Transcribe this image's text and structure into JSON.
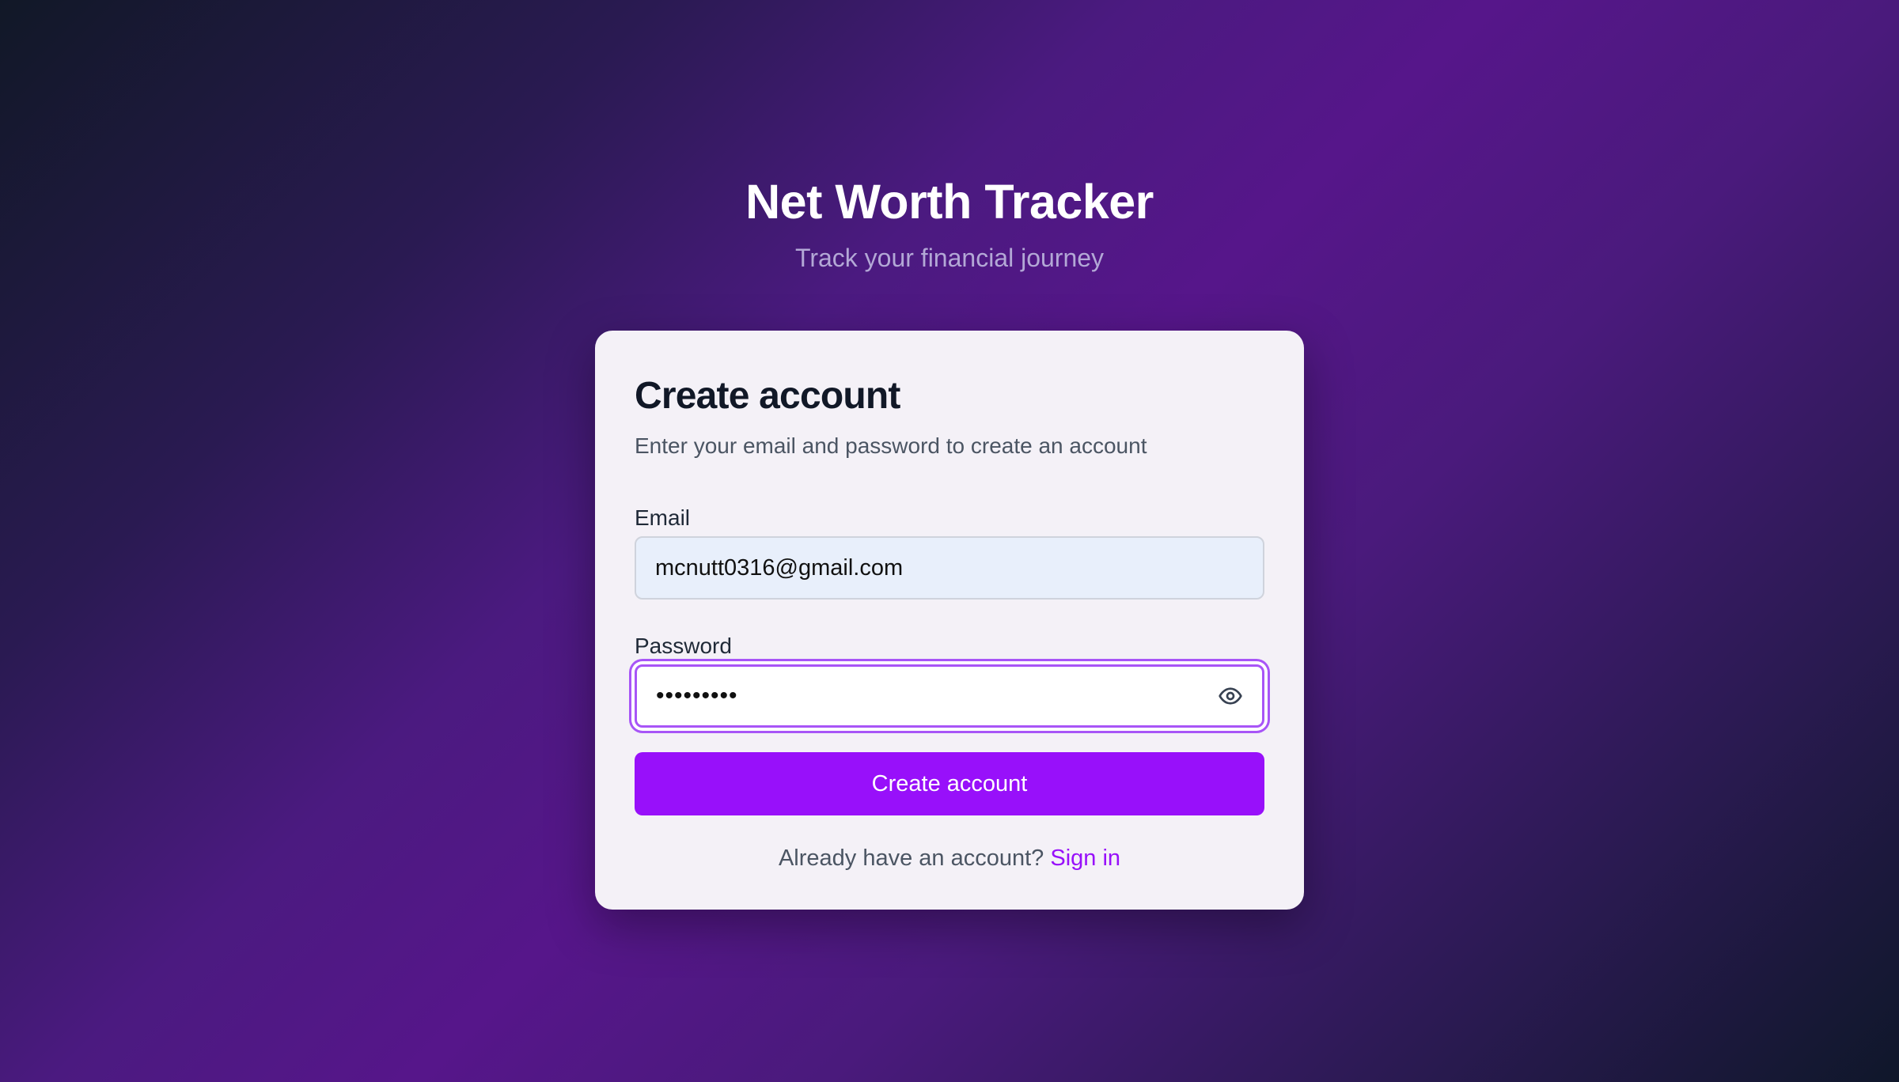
{
  "app": {
    "title": "Net Worth Tracker",
    "subtitle": "Track your financial journey"
  },
  "card": {
    "title": "Create account",
    "description": "Enter your email and password to create an account"
  },
  "form": {
    "email_label": "Email",
    "email_value": "mcnutt0316@gmail.com",
    "password_label": "Password",
    "password_value": "•••••••••",
    "password_toggle_icon": "eye-icon",
    "submit_label": "Create account"
  },
  "footer": {
    "prompt": "Already have an account?",
    "link_label": "Sign in"
  },
  "colors": {
    "accent": "#9810fa",
    "focus_ring": "#a855f7",
    "card_background": "#f4f1f7",
    "email_input_background": "#e8effb"
  }
}
